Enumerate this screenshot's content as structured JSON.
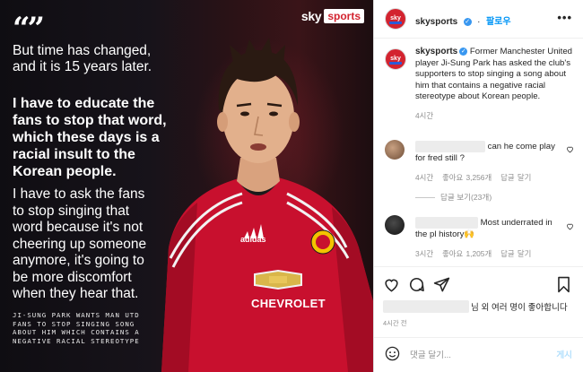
{
  "image": {
    "brand_sky": "sky",
    "brand_sports": "sports",
    "quote_mark": "“”",
    "quote_lines_1": [
      "But time has changed,",
      "and it is 15 years later."
    ],
    "quote_lines_2": [
      "I have to educate the",
      "fans to stop that word,",
      "which these days is a",
      "racial insult to the",
      "Korean people."
    ],
    "quote_lines_3": [
      "I have to ask the fans",
      "to stop singing that",
      "word because it's not",
      "cheering up someone",
      "anymore, it's going to",
      "be more discomfort",
      "when they hear that."
    ],
    "caption_lines": [
      "JI-SUNG PARK WANTS MAN UTD",
      "FANS TO STOP SINGING SONG",
      "ABOUT HIM WHICH CONTAINS A",
      "NEGATIVE RACIAL STEREOTYPE"
    ],
    "shirt_sponsor": "CHEVROLET",
    "kit_brand": "adidas"
  },
  "header": {
    "username": "skysports",
    "verified": "✓",
    "follow_label": "팔로우",
    "more_label": "•••"
  },
  "caption": {
    "username": "skysports",
    "text": "Former Manchester United player Ji-Sung Park has asked the club's supporters to stop singing a song about him that contains a negative racial stereotype about Korean people.",
    "time": "4시간"
  },
  "comments": [
    {
      "text": "can he come play for fred still ?",
      "time": "4시간",
      "likes": "좋아요 3,256개",
      "reply": "답글 달기",
      "view_replies": "답글 보기(23개)"
    },
    {
      "text": "Most underrated in the pl history🙌",
      "time": "3시간",
      "likes": "좋아요 1,205개",
      "reply": "답글 달기"
    }
  ],
  "actions": {
    "like_icon": "heart-icon",
    "comment_icon": "comment-icon",
    "share_icon": "share-icon",
    "save_icon": "bookmark-icon"
  },
  "likes_suffix": "님 외 여러 명이 좋아합니다",
  "post_time": "4시간 전",
  "comment_input": {
    "placeholder": "댓글 달기...",
    "post_label": "게시"
  },
  "colors": {
    "sky_red": "#d3232f",
    "instagram_blue": "#0095f6",
    "united_red": "#c8102e"
  }
}
